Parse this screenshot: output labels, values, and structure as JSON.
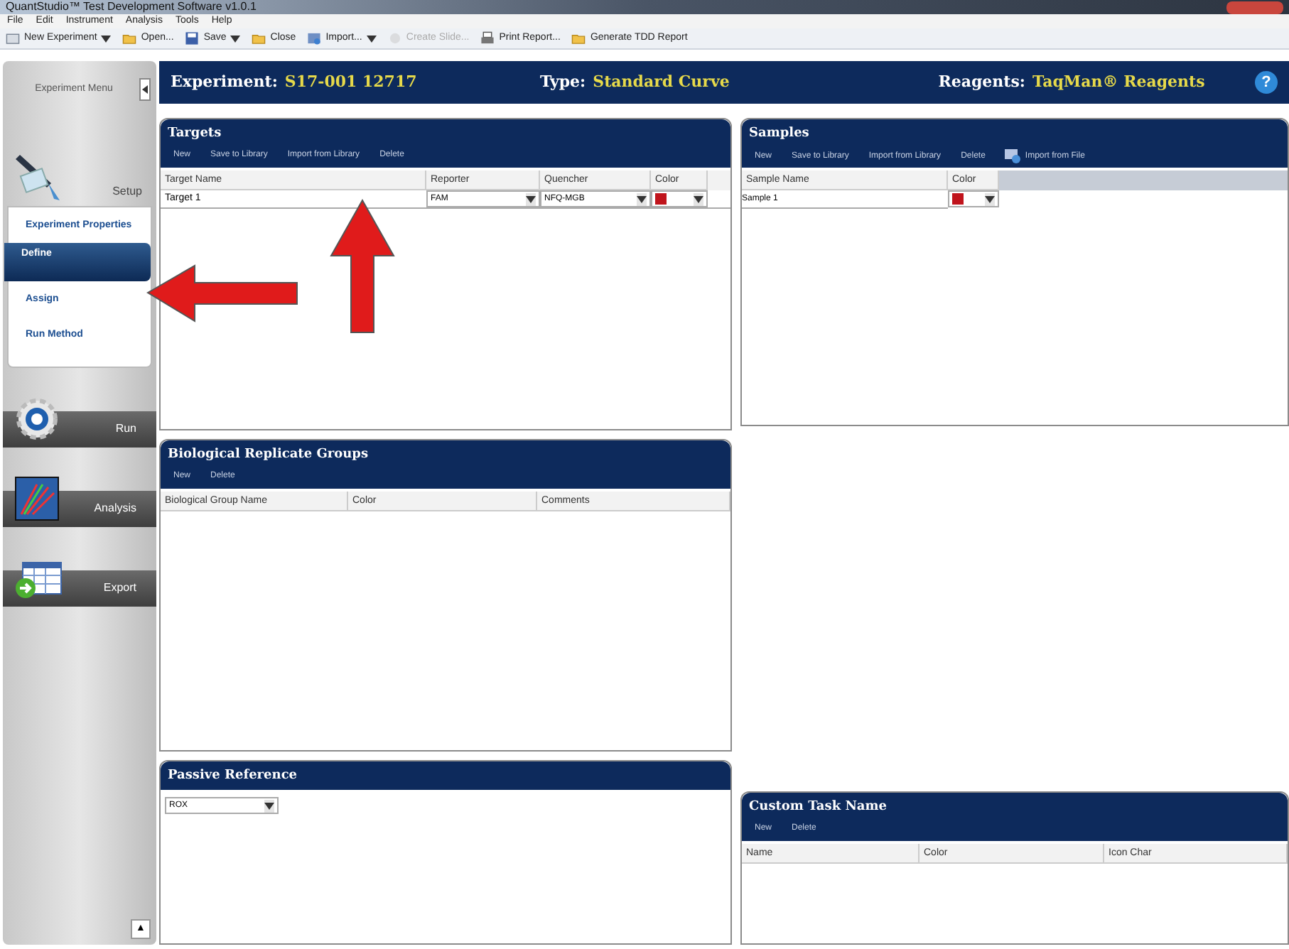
{
  "window": {
    "title": "QuantStudio™ Test Development Software v1.0.1"
  },
  "menu": [
    "File",
    "Edit",
    "Instrument",
    "Analysis",
    "Tools",
    "Help"
  ],
  "toolbar": [
    {
      "label": "New Experiment",
      "dropdown": true,
      "disabled": false,
      "kind": "new"
    },
    {
      "label": "Open...",
      "dropdown": false,
      "disabled": false,
      "kind": "folder"
    },
    {
      "label": "Save",
      "dropdown": true,
      "disabled": false,
      "kind": "save"
    },
    {
      "label": "Close",
      "dropdown": false,
      "disabled": false,
      "kind": "folder"
    },
    {
      "label": "Import...",
      "dropdown": true,
      "disabled": false,
      "kind": "import"
    },
    {
      "label": "Create Slide...",
      "dropdown": false,
      "disabled": true,
      "kind": "slide"
    },
    {
      "label": "Print Report...",
      "dropdown": false,
      "disabled": false,
      "kind": "print"
    },
    {
      "label": "Generate TDD Report",
      "dropdown": false,
      "disabled": false,
      "kind": "folder"
    }
  ],
  "sidebar": {
    "title": "Experiment Menu",
    "setup": {
      "label": "Setup",
      "items": [
        {
          "label": "Experiment Properties",
          "selected": false
        },
        {
          "label": "Define",
          "selected": true
        },
        {
          "label": "Assign",
          "selected": false
        },
        {
          "label": "Run Method",
          "selected": false
        }
      ]
    },
    "sections": [
      {
        "label": "Run",
        "kind": "run"
      },
      {
        "label": "Analysis",
        "kind": "analysis"
      },
      {
        "label": "Export",
        "kind": "export"
      }
    ],
    "scroll_button": "▲"
  },
  "header": [
    {
      "label": "Experiment:",
      "value": "S17-001 12717"
    },
    {
      "label": "Type:",
      "value": "Standard Curve"
    },
    {
      "label": "Reagents:",
      "value": "TaqMan® Reagents"
    }
  ],
  "help": "?",
  "targets": {
    "title": "Targets",
    "actions": [
      "New",
      "Save to Library",
      "Import from Library",
      "Delete"
    ],
    "columns": [
      "Target Name",
      "Reporter",
      "Quencher",
      "Color"
    ],
    "rows": [
      {
        "name": "Target 1",
        "reporter": "FAM",
        "quencher": "NFQ-MGB",
        "color": "#c0141c"
      }
    ]
  },
  "samples": {
    "title": "Samples",
    "actions": [
      "New",
      "Save to Library",
      "Import from Library",
      "Delete",
      "Import from File"
    ],
    "columns": [
      "Sample Name",
      "Color"
    ],
    "rows": [
      {
        "name": "Sample 1",
        "color": "#c0141c"
      }
    ]
  },
  "bio_groups": {
    "title": "Biological Replicate Groups",
    "actions": [
      "New",
      "Delete"
    ],
    "columns": [
      "Biological Group Name",
      "Color",
      "Comments"
    ]
  },
  "passive_reference": {
    "title": "Passive Reference",
    "value": "ROX"
  },
  "custom_task": {
    "title": "Custom Task Name",
    "actions": [
      "New",
      "Delete"
    ],
    "columns": [
      "Name",
      "Color",
      "Icon Char"
    ]
  }
}
